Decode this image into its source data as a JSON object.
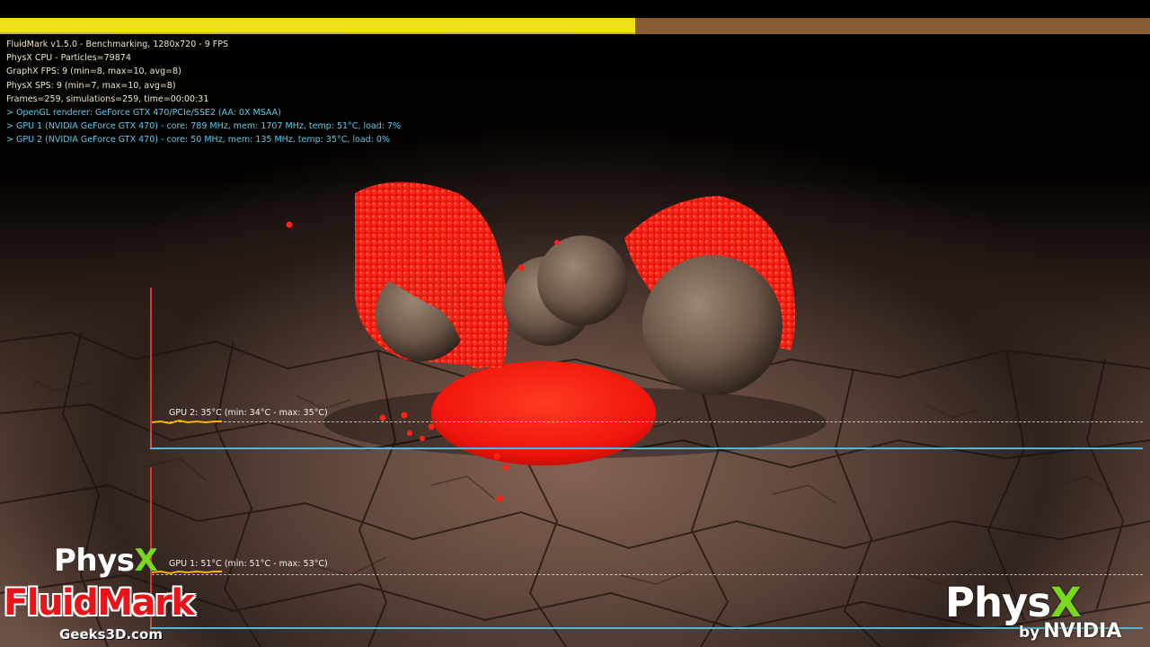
{
  "progress": {
    "fraction": 0.552,
    "fill_color": "#f0e01a",
    "track_color": "#8a5c33"
  },
  "stats": {
    "line1": "FluidMark v1.5.0 - Benchmarking, 1280x720 - 9 FPS",
    "line2": "PhysX CPU - Particles=79874",
    "line3": "GraphX FPS: 9 (min=8, max=10, avg=8)",
    "line4": "PhysX SPS: 9 (min=7, max=10, avg=8)",
    "line5": "Frames=259, simulations=259, time=00:00:31",
    "line6": "> OpenGL renderer: GeForce GTX 470/PCIe/SSE2 (AA: 0X MSAA)",
    "line7": "> GPU 1 (NVIDIA GeForce GTX 470) - core: 789 MHz, mem: 1707 MHz, temp: 51°C, load: 7%",
    "line8": "> GPU 2 (NVIDIA GeForce GTX 470) - core: 50 MHz, mem: 135 MHz, temp: 35°C, load: 0%"
  },
  "graphs": {
    "gpu2": {
      "label": "GPU 2: 35°C (min: 34°C - max: 35°C)"
    },
    "gpu1": {
      "label": "GPU 1: 51°C (min: 51°C - max: 53°C)"
    }
  },
  "logos": {
    "physx_left_text": "Phys",
    "physx_left_x": "X",
    "fluidmark": "FluidMark",
    "geeks3d": "Geeks3D.com",
    "physx_right_text": "Phys",
    "physx_right_x": "X",
    "by": "by",
    "nvidia": "NVIDIA"
  },
  "colors": {
    "particles": "#ff1a10",
    "stat_text": "#f1e8c6",
    "gpu_text": "#5fc9e6",
    "axis_vertical": "#e0332c",
    "axis_horizontal": "#4fb8d6",
    "nvidia_green": "#7ad81c"
  }
}
